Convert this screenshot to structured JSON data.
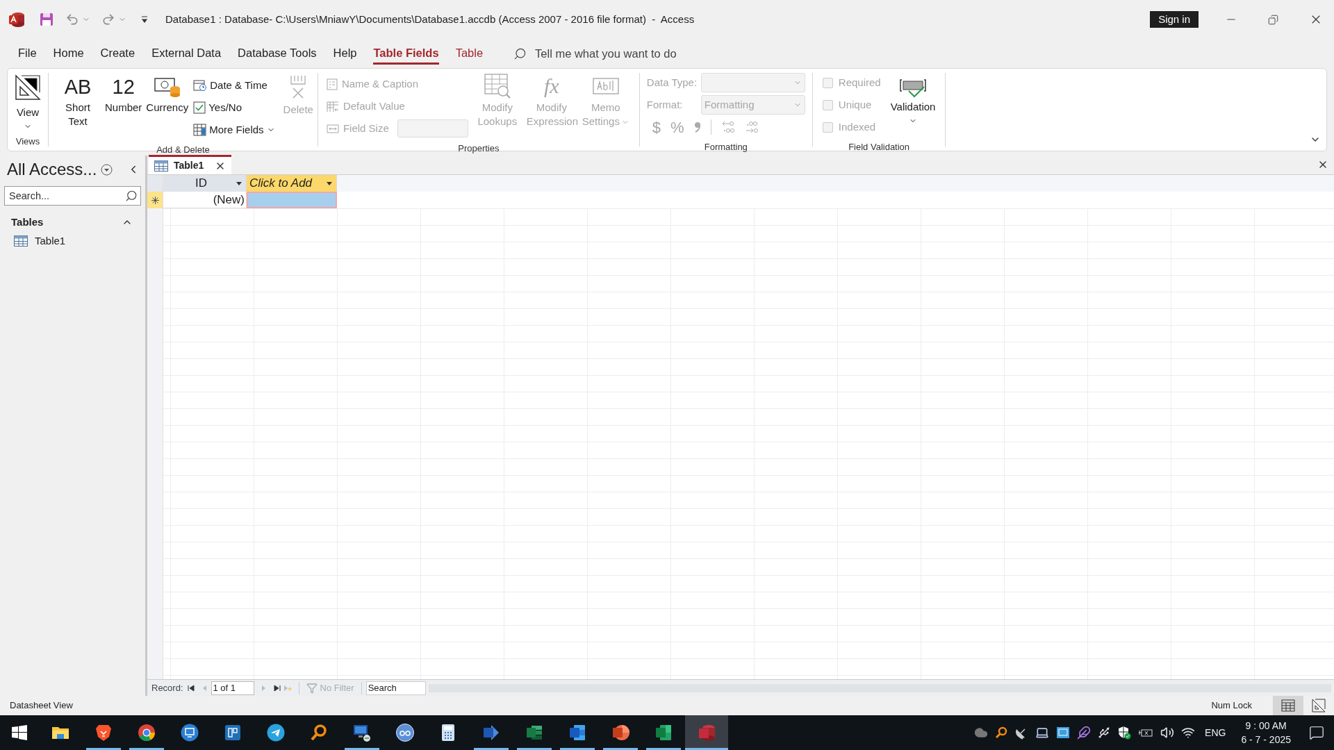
{
  "title_bar": {
    "title": "Database1 : Database- C:\\Users\\MniawY\\Documents\\Database1.accdb (Access 2007 - 2016 file format)  -  Access",
    "sign_in": "Sign in"
  },
  "menu_tabs": [
    {
      "label": "File",
      "selected": false,
      "contextual": false
    },
    {
      "label": "Home",
      "selected": false,
      "contextual": false
    },
    {
      "label": "Create",
      "selected": false,
      "contextual": false
    },
    {
      "label": "External Data",
      "selected": false,
      "contextual": false
    },
    {
      "label": "Database Tools",
      "selected": false,
      "contextual": false
    },
    {
      "label": "Help",
      "selected": false,
      "contextual": false
    },
    {
      "label": "Table Fields",
      "selected": true,
      "contextual": true
    },
    {
      "label": "Table",
      "selected": false,
      "contextual": true
    }
  ],
  "tell_me": {
    "placeholder": "Tell me what you want to do"
  },
  "ribbon": {
    "views": {
      "label": "Views",
      "button": {
        "label": "View",
        "disabled": false
      }
    },
    "add_delete": {
      "label": "Add & Delete",
      "large_buttons": [
        {
          "kind": "text",
          "glyph": "AB",
          "label": "Short Text"
        },
        {
          "kind": "number",
          "glyph": "12",
          "label": "Number"
        },
        {
          "kind": "currency",
          "label": "Currency"
        }
      ],
      "small_buttons": [
        {
          "kind": "date",
          "label": "Date & Time",
          "menu": false
        },
        {
          "kind": "yesno",
          "label": "Yes/No",
          "menu": false
        },
        {
          "kind": "more",
          "label": "More Fields",
          "menu": true
        }
      ],
      "delete": {
        "label": "Delete",
        "disabled": true
      }
    },
    "properties": {
      "label": "Properties",
      "small_buttons": [
        {
          "kind": "caption",
          "label": "Name & Caption",
          "disabled": true
        },
        {
          "kind": "default",
          "label": "Default Value",
          "disabled": true
        }
      ],
      "field_size": {
        "label": "Field Size",
        "disabled": true
      },
      "large_buttons": [
        {
          "kind": "lookups",
          "label": "Modify Lookups",
          "disabled": true,
          "menu": false
        },
        {
          "kind": "expression",
          "glyph": "fx",
          "label": "Modify Expression",
          "disabled": true,
          "menu": false
        },
        {
          "kind": "memo",
          "label": "Memo Settings",
          "disabled": true,
          "menu": true
        }
      ]
    },
    "formatting": {
      "label": "Formatting",
      "data_type": {
        "label": "Data Type:",
        "disabled": true
      },
      "format": {
        "label": "Format:",
        "value": "Formatting",
        "disabled": true
      },
      "symbols": [
        "$",
        "%"
      ]
    },
    "field_validation": {
      "label": "Field Validation",
      "checkboxes": [
        {
          "label": "Required",
          "checked": false,
          "disabled": true
        },
        {
          "label": "Unique",
          "checked": false,
          "disabled": true
        },
        {
          "label": "Indexed",
          "checked": false,
          "disabled": true
        }
      ],
      "validation": {
        "label": "Validation"
      }
    }
  },
  "nav_pane": {
    "title": "All Access...",
    "search": {
      "placeholder": "Search..."
    },
    "groups": [
      {
        "label": "Tables",
        "expanded": true,
        "items": [
          {
            "label": "Table1",
            "selected": false
          }
        ]
      }
    ]
  },
  "document": {
    "tabs": [
      {
        "label": "Table1",
        "selected": true
      }
    ],
    "datasheet": {
      "columns": [
        {
          "label": "ID",
          "kind": "field"
        },
        {
          "label": "Click to Add",
          "kind": "add"
        }
      ],
      "new_row": [
        {
          "value": "(New)",
          "selected": false
        },
        {
          "selected": true
        }
      ]
    },
    "record_nav": {
      "label": "Record:",
      "position": "1 of 1",
      "filter": "No Filter",
      "search": {
        "placeholder": "Search"
      }
    }
  },
  "status_bar": {
    "text": "Datasheet View",
    "indicators": [
      "Num Lock"
    ],
    "view_buttons": [
      {
        "kind": "datasheet",
        "selected": true
      },
      {
        "kind": "design",
        "selected": false
      }
    ]
  },
  "taskbar": {
    "apps": [
      {
        "kind": "explorer",
        "running": false,
        "active": false
      },
      {
        "kind": "brave",
        "running": true,
        "active": false
      },
      {
        "kind": "chrome",
        "running": true,
        "active": false
      },
      {
        "kind": "remote",
        "running": false,
        "active": false
      },
      {
        "kind": "mouse",
        "running": false,
        "active": false
      },
      {
        "kind": "telegram",
        "running": false,
        "active": false
      },
      {
        "kind": "everything",
        "running": false,
        "active": false
      },
      {
        "kind": "rdp",
        "running": true,
        "active": false
      },
      {
        "kind": "qbit",
        "running": false,
        "active": false
      },
      {
        "kind": "calculator",
        "running": false,
        "active": false
      },
      {
        "kind": "visio",
        "running": true,
        "active": false
      },
      {
        "kind": "project",
        "running": true,
        "active": false
      },
      {
        "kind": "word",
        "running": true,
        "active": false
      },
      {
        "kind": "powerpoint",
        "running": true,
        "active": false
      },
      {
        "kind": "excel",
        "running": true,
        "active": false
      },
      {
        "kind": "access",
        "running": true,
        "active": true
      }
    ],
    "language": "ENG",
    "time": "9 : 00 AM",
    "date": "6 - 7 - 2025"
  }
}
